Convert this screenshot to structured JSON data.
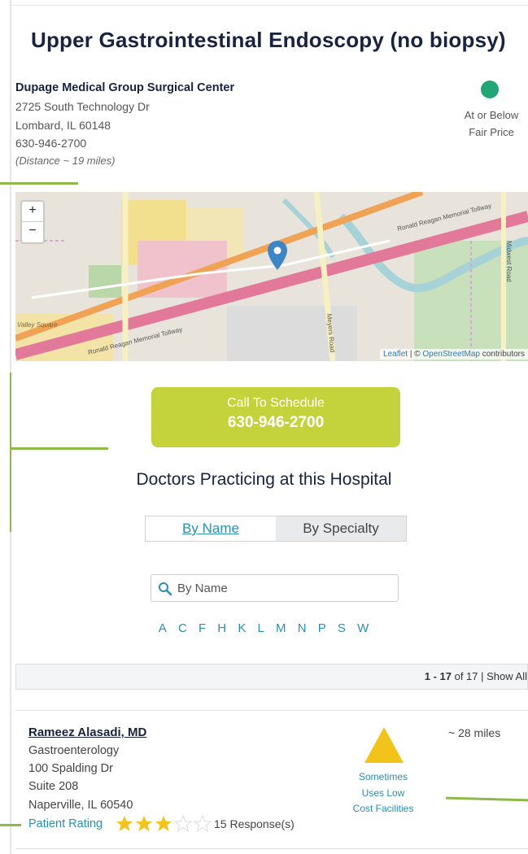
{
  "page": {
    "title": "Upper Gastrointestinal Endoscopy (no biopsy)"
  },
  "facility": {
    "name": "Dupage Medical Group Surgical Center",
    "address1": "2725 South Technology Dr",
    "address2": "Lombard, IL 60148",
    "phone": "630-946-2700",
    "distance": "(Distance ~ 19 miles)",
    "price_status": {
      "color": "#22a678",
      "line1": "At or Below",
      "line2": "Fair Price"
    }
  },
  "map": {
    "zoom_in": "+",
    "zoom_out": "−",
    "attribution_leaflet": "Leaflet",
    "attribution_sep": " | © ",
    "attribution_osm": "OpenStreetMap",
    "attribution_tail": " contributors",
    "road_label_1": "Ronald Reagan Memorial Tollway",
    "road_label_2": "Ronald Reagan Memorial Tollway",
    "road_label_3": "Meyers Road",
    "road_label_4": "Midwest Road",
    "place_label": "Valley Square"
  },
  "cta": {
    "line1": "Call To Schedule",
    "line2": "630-946-2700",
    "color": "#c4d33b"
  },
  "doctors": {
    "heading": "Doctors Practicing at this Hospital",
    "tabs": [
      {
        "label": "By Name",
        "active": true
      },
      {
        "label": "By Specialty",
        "active": false
      }
    ],
    "search_placeholder": "By Name",
    "letters": [
      "A",
      "C",
      "F",
      "H",
      "K",
      "L",
      "M",
      "N",
      "P",
      "S",
      "W"
    ],
    "pager": {
      "range": "1 - 17",
      "of": " of 17 | ",
      "show_all": "Show All"
    }
  },
  "doctor_list": [
    {
      "name": "Rameez Alasadi, MD",
      "specialty": "Gastroenterology",
      "address1": "100 Spalding Dr",
      "address2": "Suite 208",
      "address3": "Naperville, IL 60540",
      "rating_label": "Patient Rating",
      "rating": 3,
      "rating_max": 5,
      "responses": "15 Response(s)",
      "cost_status": {
        "icon": "warning-triangle-icon",
        "color": "#f2c31b",
        "line1": "Sometimes",
        "line2": "Uses Low",
        "line3": "Cost Facilities"
      },
      "distance": "~ 28 miles"
    }
  ],
  "colors": {
    "accent_blue": "#2a8fb0",
    "navy": "#17233f",
    "connector_green": "#8db94a"
  }
}
